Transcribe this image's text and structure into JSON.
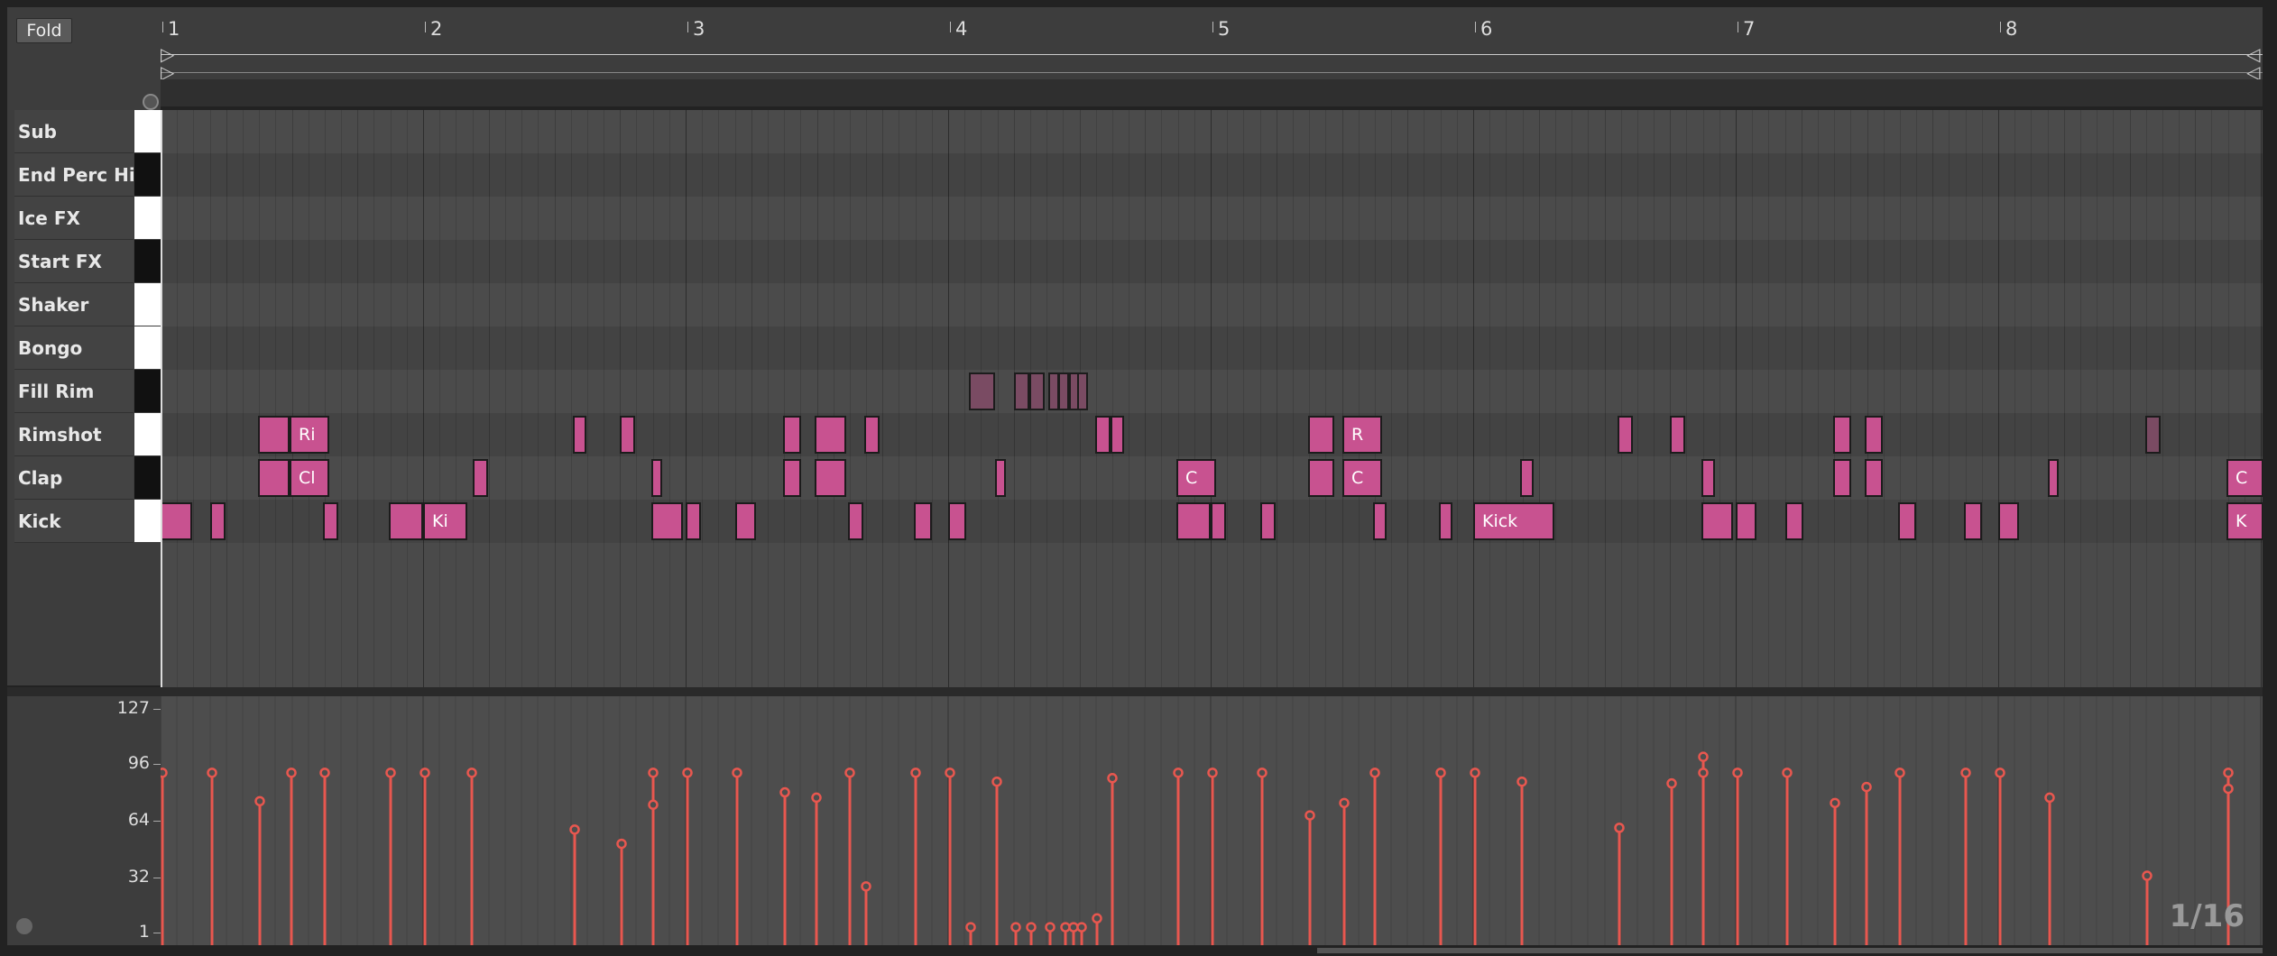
{
  "fold_label": "Fold",
  "bar_numbers": [
    "1",
    "2",
    "3",
    "4",
    "5",
    "6",
    "7",
    "8"
  ],
  "lanes": [
    {
      "name": "Sub",
      "key": "white"
    },
    {
      "name": "End Perc Hit",
      "key": "black"
    },
    {
      "name": "Ice FX",
      "key": "white"
    },
    {
      "name": "Start FX",
      "key": "black"
    },
    {
      "name": "Shaker",
      "key": "white"
    },
    {
      "name": "Bongo",
      "key": "white"
    },
    {
      "name": "Fill Rim",
      "key": "black"
    },
    {
      "name": "Rimshot",
      "key": "white"
    },
    {
      "name": "Clap",
      "key": "black"
    },
    {
      "name": "Kick",
      "key": "white"
    }
  ],
  "notes": [
    {
      "lane": 6,
      "start": 3.08,
      "dur": 0.1,
      "label": "",
      "dim": true
    },
    {
      "lane": 6,
      "start": 3.25,
      "dur": 0.06,
      "label": "",
      "dim": true
    },
    {
      "lane": 6,
      "start": 3.31,
      "dur": 0.06,
      "label": "",
      "dim": true
    },
    {
      "lane": 6,
      "start": 3.38,
      "dur": 0.04,
      "label": "",
      "dim": true
    },
    {
      "lane": 6,
      "start": 3.42,
      "dur": 0.04,
      "label": "",
      "dim": true
    },
    {
      "lane": 6,
      "start": 3.46,
      "dur": 0.03,
      "label": "",
      "dim": true
    },
    {
      "lane": 6,
      "start": 3.49,
      "dur": 0.03,
      "label": "",
      "dim": true
    },
    {
      "lane": 7,
      "start": 0.37,
      "dur": 0.12,
      "label": ""
    },
    {
      "lane": 7,
      "start": 0.49,
      "dur": 0.15,
      "label": "Ri"
    },
    {
      "lane": 7,
      "start": 1.57,
      "dur": 0.05,
      "label": ""
    },
    {
      "lane": 7,
      "start": 1.75,
      "dur": 0.06,
      "label": ""
    },
    {
      "lane": 7,
      "start": 2.37,
      "dur": 0.07,
      "label": ""
    },
    {
      "lane": 7,
      "start": 2.49,
      "dur": 0.12,
      "label": ""
    },
    {
      "lane": 7,
      "start": 2.68,
      "dur": 0.06,
      "label": ""
    },
    {
      "lane": 7,
      "start": 3.56,
      "dur": 0.06,
      "label": ""
    },
    {
      "lane": 7,
      "start": 3.62,
      "dur": 0.05,
      "label": ""
    },
    {
      "lane": 7,
      "start": 4.37,
      "dur": 0.1,
      "label": ""
    },
    {
      "lane": 7,
      "start": 4.5,
      "dur": 0.15,
      "label": "R"
    },
    {
      "lane": 7,
      "start": 5.55,
      "dur": 0.06,
      "label": ""
    },
    {
      "lane": 7,
      "start": 5.75,
      "dur": 0.06,
      "label": ""
    },
    {
      "lane": 7,
      "start": 6.37,
      "dur": 0.07,
      "label": ""
    },
    {
      "lane": 7,
      "start": 6.49,
      "dur": 0.07,
      "label": ""
    },
    {
      "lane": 7,
      "start": 7.56,
      "dur": 0.06,
      "label": "",
      "dim": true
    },
    {
      "lane": 8,
      "start": 0.37,
      "dur": 0.12,
      "label": ""
    },
    {
      "lane": 8,
      "start": 0.49,
      "dur": 0.15,
      "label": "Cl"
    },
    {
      "lane": 8,
      "start": 1.19,
      "dur": 0.06,
      "label": ""
    },
    {
      "lane": 8,
      "start": 1.87,
      "dur": 0.04,
      "label": ""
    },
    {
      "lane": 8,
      "start": 2.37,
      "dur": 0.07,
      "label": ""
    },
    {
      "lane": 8,
      "start": 2.49,
      "dur": 0.12,
      "label": ""
    },
    {
      "lane": 8,
      "start": 3.18,
      "dur": 0.04,
      "label": ""
    },
    {
      "lane": 8,
      "start": 3.87,
      "dur": 0.15,
      "label": "C"
    },
    {
      "lane": 8,
      "start": 4.37,
      "dur": 0.1,
      "label": ""
    },
    {
      "lane": 8,
      "start": 4.5,
      "dur": 0.15,
      "label": "C"
    },
    {
      "lane": 8,
      "start": 5.18,
      "dur": 0.05,
      "label": ""
    },
    {
      "lane": 8,
      "start": 5.87,
      "dur": 0.05,
      "label": ""
    },
    {
      "lane": 8,
      "start": 6.37,
      "dur": 0.07,
      "label": ""
    },
    {
      "lane": 8,
      "start": 6.49,
      "dur": 0.07,
      "label": ""
    },
    {
      "lane": 8,
      "start": 7.19,
      "dur": 0.04,
      "label": ""
    },
    {
      "lane": 8,
      "start": 7.87,
      "dur": 0.14,
      "label": "C"
    },
    {
      "lane": 9,
      "start": 0.0,
      "dur": 0.12,
      "label": ""
    },
    {
      "lane": 9,
      "start": 0.19,
      "dur": 0.06,
      "label": ""
    },
    {
      "lane": 9,
      "start": 0.62,
      "dur": 0.06,
      "label": ""
    },
    {
      "lane": 9,
      "start": 0.87,
      "dur": 0.13,
      "label": ""
    },
    {
      "lane": 9,
      "start": 1.0,
      "dur": 0.17,
      "label": "Ki"
    },
    {
      "lane": 9,
      "start": 1.87,
      "dur": 0.12,
      "label": ""
    },
    {
      "lane": 9,
      "start": 2.0,
      "dur": 0.06,
      "label": ""
    },
    {
      "lane": 9,
      "start": 2.19,
      "dur": 0.08,
      "label": ""
    },
    {
      "lane": 9,
      "start": 2.62,
      "dur": 0.06,
      "label": ""
    },
    {
      "lane": 9,
      "start": 2.87,
      "dur": 0.07,
      "label": ""
    },
    {
      "lane": 9,
      "start": 3.0,
      "dur": 0.07,
      "label": ""
    },
    {
      "lane": 9,
      "start": 3.87,
      "dur": 0.13,
      "label": ""
    },
    {
      "lane": 9,
      "start": 4.0,
      "dur": 0.06,
      "label": ""
    },
    {
      "lane": 9,
      "start": 4.19,
      "dur": 0.06,
      "label": ""
    },
    {
      "lane": 9,
      "start": 4.62,
      "dur": 0.05,
      "label": ""
    },
    {
      "lane": 9,
      "start": 4.87,
      "dur": 0.05,
      "label": ""
    },
    {
      "lane": 9,
      "start": 5.0,
      "dur": 0.31,
      "label": "Kick"
    },
    {
      "lane": 9,
      "start": 5.87,
      "dur": 0.12,
      "label": ""
    },
    {
      "lane": 9,
      "start": 6.0,
      "dur": 0.08,
      "label": ""
    },
    {
      "lane": 9,
      "start": 6.19,
      "dur": 0.07,
      "label": ""
    },
    {
      "lane": 9,
      "start": 6.62,
      "dur": 0.07,
      "label": ""
    },
    {
      "lane": 9,
      "start": 6.87,
      "dur": 0.07,
      "label": ""
    },
    {
      "lane": 9,
      "start": 7.0,
      "dur": 0.08,
      "label": ""
    },
    {
      "lane": 9,
      "start": 7.87,
      "dur": 0.14,
      "label": "K"
    }
  ],
  "velocity": {
    "labels": [
      "127",
      "96",
      "64",
      "32",
      "1"
    ],
    "stems": [
      {
        "pos": 0.0,
        "v": 91
      },
      {
        "pos": 0.19,
        "v": 91
      },
      {
        "pos": 0.37,
        "v": 75
      },
      {
        "pos": 0.49,
        "v": 91
      },
      {
        "pos": 0.62,
        "v": 91
      },
      {
        "pos": 0.87,
        "v": 91
      },
      {
        "pos": 1.0,
        "v": 91
      },
      {
        "pos": 1.18,
        "v": 91
      },
      {
        "pos": 1.57,
        "v": 59
      },
      {
        "pos": 1.75,
        "v": 51
      },
      {
        "pos": 1.87,
        "v": 91
      },
      {
        "pos": 1.87,
        "v": 73
      },
      {
        "pos": 2.0,
        "v": 91
      },
      {
        "pos": 2.19,
        "v": 91
      },
      {
        "pos": 2.37,
        "v": 80
      },
      {
        "pos": 2.49,
        "v": 77
      },
      {
        "pos": 2.62,
        "v": 91
      },
      {
        "pos": 2.68,
        "v": 27
      },
      {
        "pos": 2.87,
        "v": 91
      },
      {
        "pos": 3.0,
        "v": 91
      },
      {
        "pos": 3.08,
        "v": 4
      },
      {
        "pos": 3.18,
        "v": 86
      },
      {
        "pos": 3.25,
        "v": 4
      },
      {
        "pos": 3.31,
        "v": 4
      },
      {
        "pos": 3.38,
        "v": 4
      },
      {
        "pos": 3.44,
        "v": 4
      },
      {
        "pos": 3.47,
        "v": 4
      },
      {
        "pos": 3.5,
        "v": 4
      },
      {
        "pos": 3.56,
        "v": 9
      },
      {
        "pos": 3.62,
        "v": 88
      },
      {
        "pos": 3.87,
        "v": 91
      },
      {
        "pos": 4.0,
        "v": 91
      },
      {
        "pos": 4.19,
        "v": 91
      },
      {
        "pos": 4.37,
        "v": 67
      },
      {
        "pos": 4.5,
        "v": 74
      },
      {
        "pos": 4.62,
        "v": 91
      },
      {
        "pos": 4.87,
        "v": 91
      },
      {
        "pos": 5.0,
        "v": 91
      },
      {
        "pos": 5.18,
        "v": 86
      },
      {
        "pos": 5.55,
        "v": 60
      },
      {
        "pos": 5.75,
        "v": 85
      },
      {
        "pos": 5.87,
        "v": 100
      },
      {
        "pos": 5.87,
        "v": 91
      },
      {
        "pos": 6.0,
        "v": 91
      },
      {
        "pos": 6.19,
        "v": 91
      },
      {
        "pos": 6.37,
        "v": 74
      },
      {
        "pos": 6.49,
        "v": 83
      },
      {
        "pos": 6.62,
        "v": 91
      },
      {
        "pos": 6.87,
        "v": 91
      },
      {
        "pos": 7.0,
        "v": 91
      },
      {
        "pos": 7.19,
        "v": 77
      },
      {
        "pos": 7.56,
        "v": 33
      },
      {
        "pos": 7.87,
        "v": 91
      },
      {
        "pos": 7.87,
        "v": 82
      }
    ]
  },
  "quantize": "1/16",
  "colors": {
    "note": "#c85290",
    "velocity": "#e8574f"
  }
}
